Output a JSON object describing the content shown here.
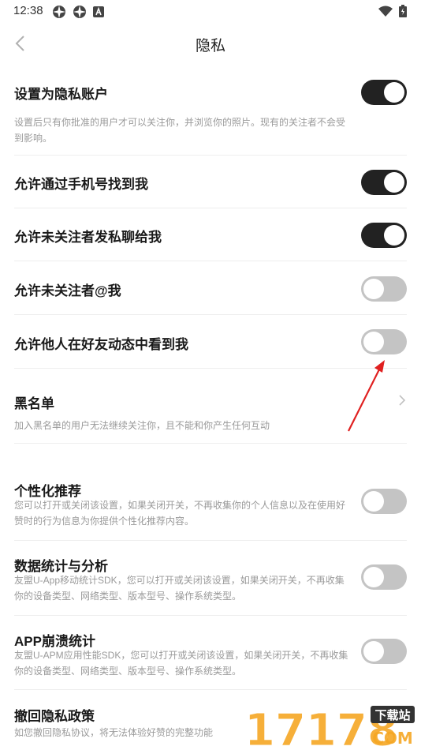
{
  "status_bar": {
    "time": "12:38",
    "left_icons": [
      "app-icon",
      "app-icon",
      "notification-a-icon"
    ],
    "right_icons": [
      "wifi-icon",
      "battery-icon"
    ]
  },
  "header": {
    "title": "隐私",
    "back_icon": "chevron-left-icon"
  },
  "settings": {
    "private_account": {
      "title": "设置为隐私账户",
      "desc": "设置后只有你批准的用户才可以关注你，并浏览你的照片。现有的关注者不会受到影响。",
      "enabled": true
    },
    "find_by_phone": {
      "title": "允许通过手机号找到我",
      "enabled": true
    },
    "message_from_nonfollowers": {
      "title": "允许未关注者发私聊给我",
      "enabled": true
    },
    "mention_from_nonfollowers": {
      "title": "允许未关注者@我",
      "enabled": false
    },
    "seen_in_friend_feed": {
      "title": "允许他人在好友动态中看到我",
      "enabled": false
    },
    "blacklist": {
      "title": "黑名单",
      "desc": "加入黑名单的用户无法继续关注你，且不能和你产生任何互动"
    },
    "personalized": {
      "title": "个性化推荐",
      "desc": "您可以打开或关闭该设置，如果关闭开关，不再收集你的个人信息以及在使用好赞时的行为信息为你提供个性化推荐内容。",
      "enabled": false
    },
    "analytics": {
      "title": "数据统计与分析",
      "desc": "友盟U-App移动统计SDK，您可以打开或关闭该设置，如果关闭开关，不再收集你的设备类型、网络类型、版本型号、操作系统类型。",
      "enabled": false
    },
    "crash_stats": {
      "title": "APP崩溃统计",
      "desc": "友盟U-APM应用性能SDK，您可以打开或关闭该设置，如果关闭开关，不再收集你的设备类型、网络类型、版本型号、操作系统类型。",
      "enabled": false
    },
    "revoke": {
      "title": "撤回隐私政策",
      "desc": "如您撤回隐私协议，将无法体验好赞的完整功能"
    }
  },
  "watermark": {
    "number": "17178",
    "badge": "下载站",
    "domain": "COM"
  },
  "colors": {
    "toggle_on": "#222222",
    "toggle_off": "#c4c4c4",
    "annotation_arrow": "#e02020",
    "watermark_orange": "#f5a623"
  }
}
